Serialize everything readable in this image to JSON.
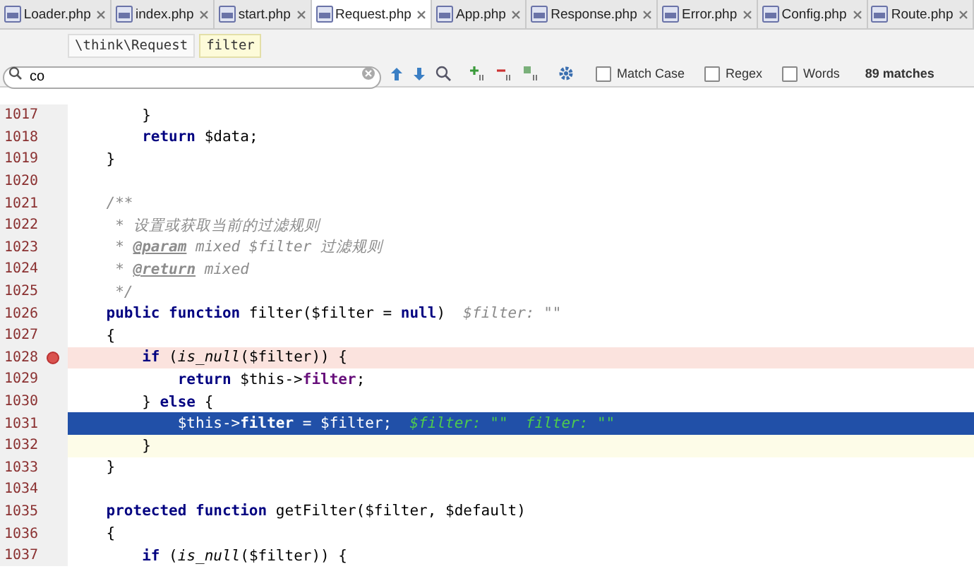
{
  "tabs": [
    {
      "label": "Loader.php",
      "selected": false
    },
    {
      "label": "index.php",
      "selected": false
    },
    {
      "label": "start.php",
      "selected": false
    },
    {
      "label": "Request.php",
      "selected": true
    },
    {
      "label": "App.php",
      "selected": false
    },
    {
      "label": "Response.php",
      "selected": false
    },
    {
      "label": "Error.php",
      "selected": false
    },
    {
      "label": "Config.php",
      "selected": false
    },
    {
      "label": "Route.php",
      "selected": false
    }
  ],
  "breadcrumb": [
    {
      "label": "\\think\\Request",
      "selected": false
    },
    {
      "label": "filter",
      "selected": true
    }
  ],
  "search": {
    "value": "co",
    "options": [
      {
        "label": "Match Case",
        "checked": false
      },
      {
        "label": "Regex",
        "checked": false
      },
      {
        "label": "Words",
        "checked": false
      }
    ],
    "matches": "89 matches"
  },
  "lines": [
    {
      "number": "1017",
      "breakpoint": false,
      "segments": [
        {
          "kind": "plain",
          "text": "        }"
        }
      ]
    },
    {
      "number": "1018",
      "breakpoint": false,
      "segments": [
        {
          "kind": "kw",
          "text": "        return"
        },
        {
          "kind": "plain",
          "text": " $data;"
        }
      ]
    },
    {
      "number": "1019",
      "breakpoint": false,
      "segments": [
        {
          "kind": "plain",
          "text": "    }"
        }
      ]
    },
    {
      "number": "1020",
      "breakpoint": false
    },
    {
      "number": "1021",
      "breakpoint": false,
      "segments": [
        {
          "kind": "comment",
          "text": "    /**"
        }
      ]
    },
    {
      "number": "1022",
      "breakpoint": false,
      "segments": [
        {
          "kind": "comment",
          "text": "     * 设置或获取当前的过滤规则"
        }
      ]
    },
    {
      "number": "1023",
      "breakpoint": false,
      "segments": [
        {
          "kind": "comment",
          "text": "     * "
        },
        {
          "kind": "doctag",
          "text": "@param"
        },
        {
          "kind": "comment",
          "text": " mixed $filter 过滤规则"
        }
      ]
    },
    {
      "number": "1024",
      "breakpoint": false,
      "segments": [
        {
          "kind": "comment",
          "text": "     * "
        },
        {
          "kind": "doctag",
          "text": "@return"
        },
        {
          "kind": "comment",
          "text": " mixed"
        }
      ]
    },
    {
      "number": "1025",
      "breakpoint": false,
      "segments": [
        {
          "kind": "comment",
          "text": "     */"
        }
      ]
    },
    {
      "number": "1026",
      "breakpoint": false,
      "segments": [
        {
          "kind": "kw",
          "text": "    public function"
        },
        {
          "kind": "plain",
          "text": " filter($filter = "
        },
        {
          "kind": "kw",
          "text": "null"
        },
        {
          "kind": "plain",
          "text": ")  "
        },
        {
          "kind": "hint",
          "text": "$filter: \"\""
        }
      ]
    },
    {
      "number": "1027",
      "breakpoint": false,
      "segments": [
        {
          "kind": "plain",
          "text": "    {"
        }
      ]
    },
    {
      "number": "1028",
      "breakpoint": true,
      "segments": [
        {
          "kind": "kw",
          "text": "        if"
        },
        {
          "kind": "plain",
          "text": " ("
        },
        {
          "kind": "fn",
          "text": "is_null"
        },
        {
          "kind": "plain",
          "text": "($filter)) {"
        }
      ]
    },
    {
      "number": "1029",
      "breakpoint": false,
      "segments": [
        {
          "kind": "kw",
          "text": "            return"
        },
        {
          "kind": "plain",
          "text": " $this->"
        },
        {
          "kind": "field",
          "text": "filter"
        },
        {
          "kind": "plain",
          "text": ";"
        }
      ]
    },
    {
      "number": "1030",
      "breakpoint": false,
      "segments": [
        {
          "kind": "plain",
          "text": "        } "
        },
        {
          "kind": "kw",
          "text": "else"
        },
        {
          "kind": "plain",
          "text": " {"
        }
      ]
    },
    {
      "number": "1031",
      "selected": true,
      "breakpoint": false,
      "segments": [
        {
          "kind": "plain",
          "text": "            $this->"
        },
        {
          "kind": "field",
          "text": "filter"
        },
        {
          "kind": "plain",
          "text": " = $filter;  "
        },
        {
          "kind": "hint",
          "text": "$filter: \"\"  filter: \"\""
        }
      ]
    },
    {
      "number": "1032",
      "caret": true,
      "breakpoint": false,
      "segments": [
        {
          "kind": "plain",
          "text": "        }"
        }
      ]
    },
    {
      "number": "1033",
      "breakpoint": false,
      "segments": [
        {
          "kind": "plain",
          "text": "    }"
        }
      ]
    },
    {
      "number": "1034",
      "breakpoint": false
    },
    {
      "number": "1035",
      "breakpoint": false,
      "segments": [
        {
          "kind": "kw",
          "text": "    protected function"
        },
        {
          "kind": "plain",
          "text": " getFilter($filter, $default)"
        }
      ]
    },
    {
      "number": "1036",
      "breakpoint": false,
      "segments": [
        {
          "kind": "plain",
          "text": "    {"
        }
      ]
    },
    {
      "number": "1037",
      "breakpoint": false,
      "segments": [
        {
          "kind": "kw",
          "text": "        if"
        },
        {
          "kind": "plain",
          "text": " ("
        },
        {
          "kind": "fn",
          "text": "is_null"
        },
        {
          "kind": "plain",
          "text": "($filter)) {"
        }
      ]
    }
  ]
}
